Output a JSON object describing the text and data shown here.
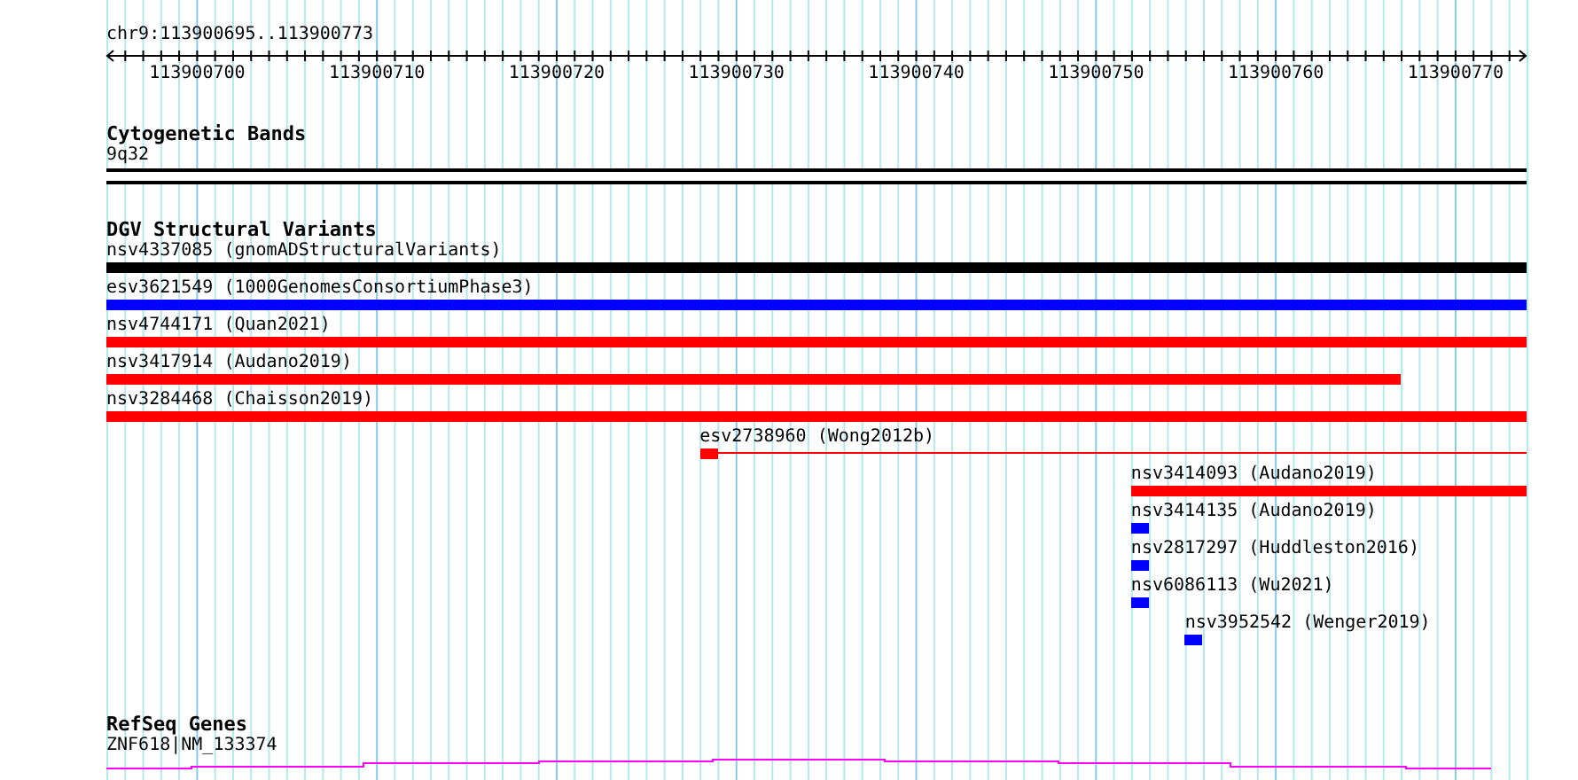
{
  "ruler": {
    "range_label": "chr9:113900695..113900773",
    "tick_labels": [
      "113900700",
      "113900710",
      "113900720",
      "113900730",
      "113900740",
      "113900750",
      "113900760",
      "113900770"
    ]
  },
  "cytogenetic_bands": {
    "title": "Cytogenetic Bands",
    "band": "9q32"
  },
  "dgv_structural_variants": {
    "title": "DGV Structural Variants",
    "features": [
      {
        "label": "nsv4337085 (gnomADStructuralVariants)",
        "color": "#000000",
        "kind": "block"
      },
      {
        "label": "esv3621549 (1000GenomesConsortiumPhase3)",
        "color": "#0000ff",
        "kind": "block"
      },
      {
        "label": "nsv4744171 (Quan2021)",
        "color": "#ff0000",
        "kind": "block"
      },
      {
        "label": "nsv3417914 (Audano2019)",
        "color": "#ff0000",
        "kind": "block"
      },
      {
        "label": "nsv3284468 (Chaisson2019)",
        "color": "#ff0000",
        "kind": "block"
      },
      {
        "label": "esv2738960 (Wong2012b)",
        "color": "#ff0000",
        "kind": "block_with_tail"
      },
      {
        "label": "nsv3414093 (Audano2019)",
        "color": "#ff0000",
        "kind": "block"
      },
      {
        "label": "nsv3414135 (Audano2019)",
        "color": "#0000ff",
        "kind": "block"
      },
      {
        "label": "nsv2817297 (Huddleston2016)",
        "color": "#0000ff",
        "kind": "block"
      },
      {
        "label": "nsv6086113 (Wu2021)",
        "color": "#0000ff",
        "kind": "block"
      },
      {
        "label": "nsv3952542 (Wenger2019)",
        "color": "#0000ff",
        "kind": "block"
      }
    ]
  },
  "refseq_genes": {
    "title": "RefSeq Genes",
    "gene": "ZNF618|NM_133374"
  }
}
